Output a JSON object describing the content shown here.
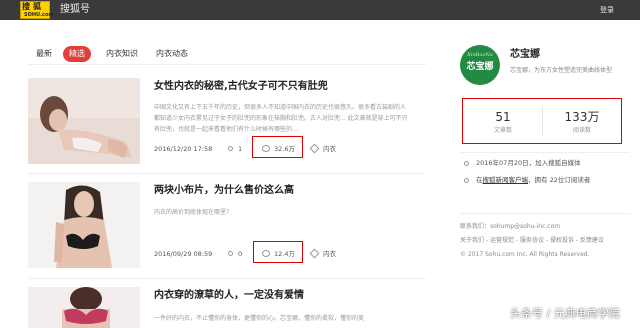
{
  "header": {
    "logo_line1": "搜狐",
    "logo_line2": "SOHU.com",
    "brand": "搜狐号",
    "login": "登录"
  },
  "tabs": [
    {
      "label": "最新",
      "active": false
    },
    {
      "label": "精选",
      "active": true
    },
    {
      "label": "内衣知识",
      "active": false
    },
    {
      "label": "内衣动态",
      "active": false
    }
  ],
  "articles": [
    {
      "title": "女性内衣的秘密,古代女子可不只有肚兜",
      "summary": "中国文化又有上下五千年的历史，但很多人不知道中国内衣的历史也很悠久。很多看古装剧的人都知道少女内衣累见过于女子的肚兜的形象在抹胸和肚兜。古人对肚兜... 此文章就是穿上可不只有肚兜，也就是一起来看看他们有什么时候有哪些的...",
      "date": "2016/12/20 17:58",
      "comments": "1",
      "views": "32.6万",
      "tag": "内衣"
    },
    {
      "title": "两块小布片，为什么售价这么高",
      "summary": "内衣的高价到底体现在哪里？",
      "date": "2016/09/29 08:59",
      "comments": "0",
      "views": "12.4万",
      "tag": "内衣"
    },
    {
      "title": "内衣穿的潦草的人，一定没有爱情",
      "summary": "一件好的内衣，不止懂你的身体，更懂你的心。芯宝娜，懂你的柔软，懂你的美"
    }
  ],
  "sidebar": {
    "avatar_line1": "XinBaoNa",
    "avatar_line2": "芯宝娜",
    "name": "芯宝娜",
    "desc": "芯宝娜，为东方女性塑造完美曲线体型",
    "stats": [
      {
        "value": "51",
        "label": "文章数"
      },
      {
        "value": "133万",
        "label": "阅读数"
      }
    ],
    "joined": "2016年07月20日，加入搜狐自媒体",
    "subscribe_prefix": "在",
    "subscribe_link": "搜狐新闻客户端",
    "subscribe_suffix": "，拥有 22位订阅读者",
    "contact": "联系我们：sohump@sohu-inc.com",
    "about_links": "关于我们 - 运营规范 - 服务协议 - 侵权投诉 - 反馈建议",
    "copyright": "© 2017 Sohu.com Inc. All Rights Reserved."
  },
  "watermark": "头条号 / 元典电商学院",
  "colors": {
    "accent": "#e33f38",
    "highlight_border": "#e10000",
    "topbar": "#3a3a3a",
    "logo": "#ffd100",
    "avatar": "#238a43"
  }
}
